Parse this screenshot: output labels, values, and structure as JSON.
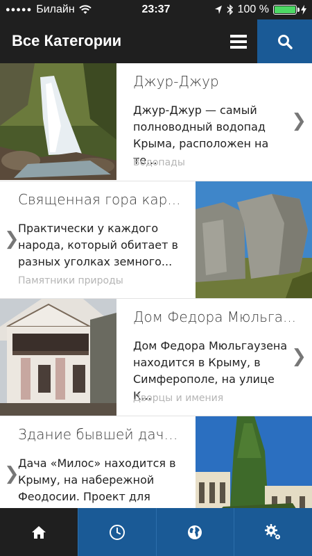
{
  "status_bar": {
    "carrier": "Билайн",
    "time": "23:37",
    "battery_text": "100 %",
    "battery_level": 1.0
  },
  "header": {
    "title": "Все Категории"
  },
  "items": [
    {
      "title": "Джур-Джур",
      "description": "Джур-Джур — самый полноводный водопад Крыма, расположен на те...",
      "category": "Водопады"
    },
    {
      "title": "Священная гора кар...",
      "description": "Практически у каждого народа, который обитает в разных уголках земного...",
      "category": "Памятники природы"
    },
    {
      "title": "Дом Федора Мюльга...",
      "description": "Дом Федора Мюльгаузена находится в Крыму, в Симферополе, на улице К...",
      "category": "Дворцы и имения"
    },
    {
      "title": "Здание бывшей дачи...",
      "description": "Дача «Милос» находится в Крыму, на набережной Феодосии. Проект для зда...",
      "category": ""
    }
  ],
  "icons": {
    "menu": "menu-icon",
    "search": "search-icon",
    "home": "home-icon",
    "clock": "clock-icon",
    "globe": "globe-icon",
    "settings": "settings-icon",
    "chevron": "chevron-right-icon"
  },
  "colors": {
    "header_bg": "#1f1f1f",
    "accent_blue": "#1a5a96",
    "category_gray": "#b5b5b5"
  }
}
